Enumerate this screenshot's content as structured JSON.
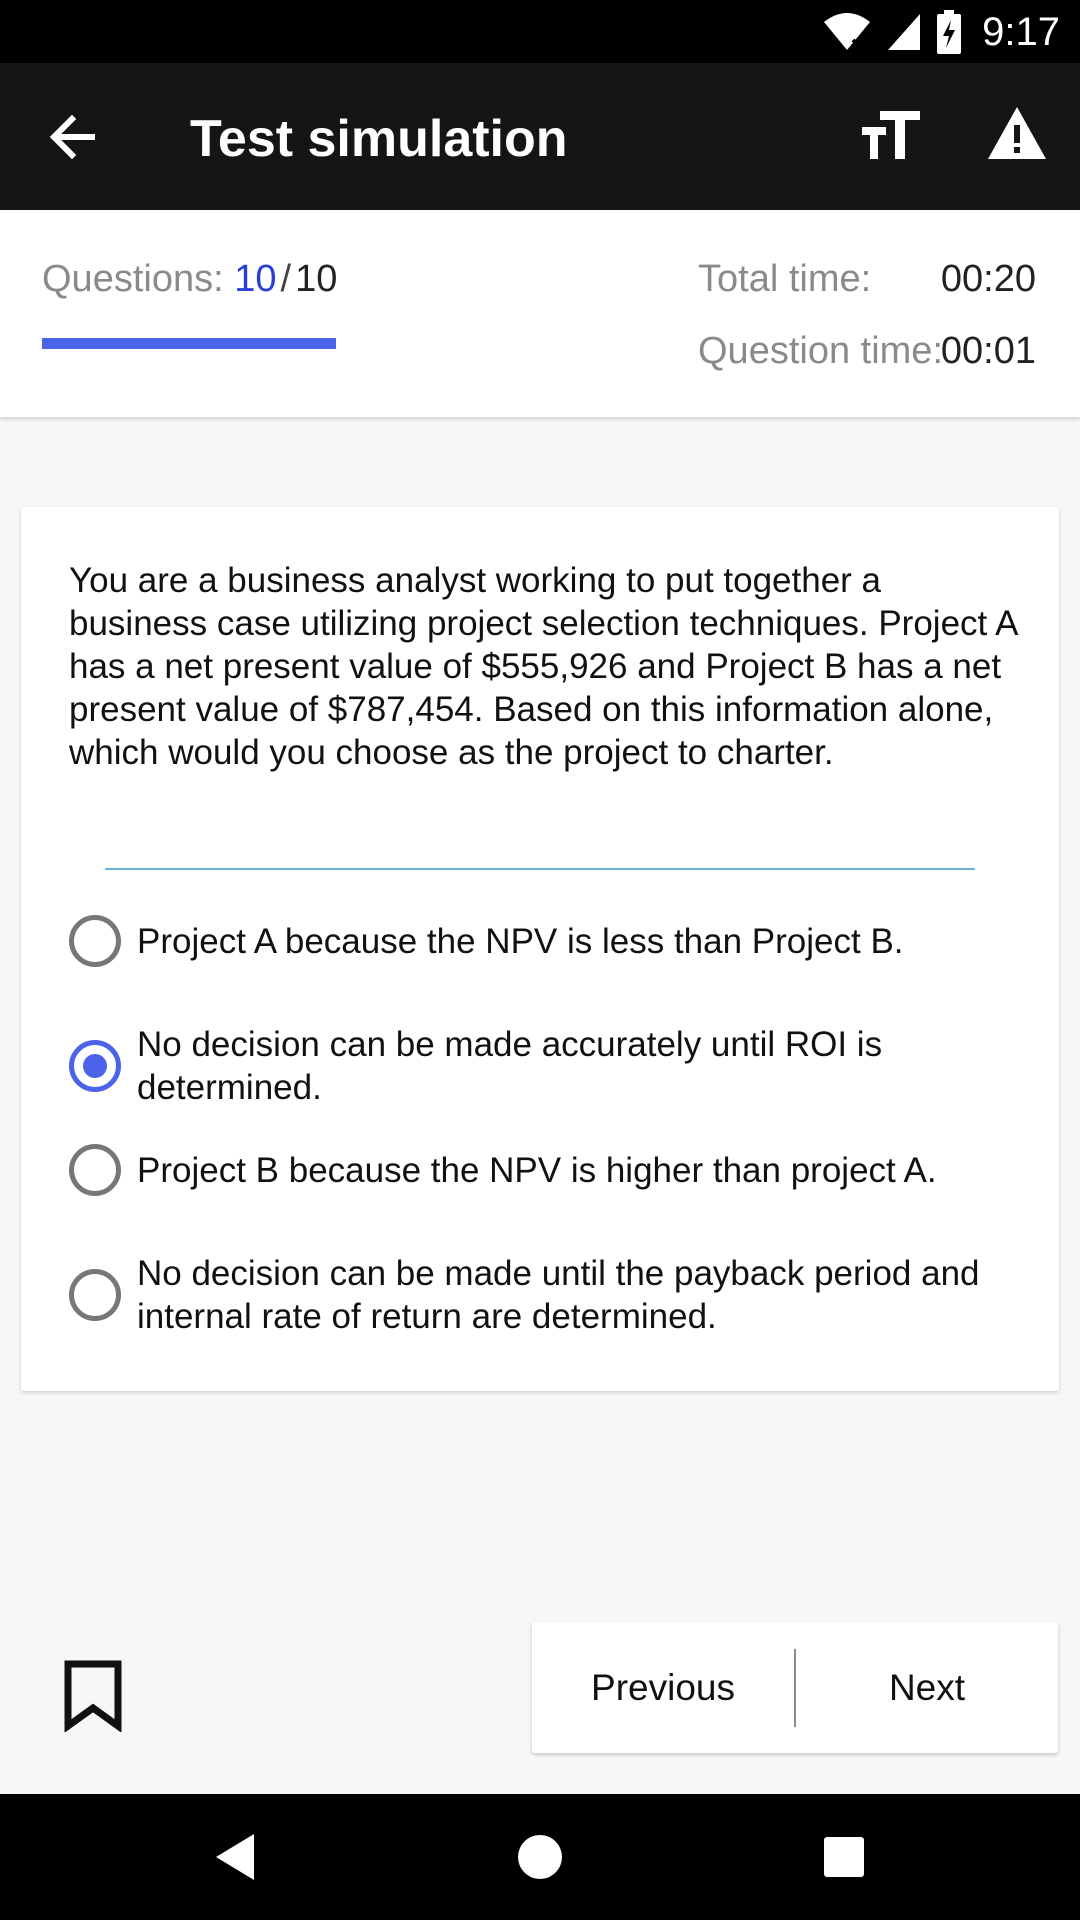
{
  "status_bar": {
    "time": "9:17"
  },
  "app_bar": {
    "title": "Test simulation"
  },
  "stats": {
    "questions_label": "Questions:",
    "current_question": "10",
    "separator": "/",
    "total_questions": "10",
    "progress_fraction": 1.0,
    "total_time_label": "Total time:",
    "total_time_value": "00:20",
    "question_time_label": "Question time:",
    "question_time_value": "00:01"
  },
  "question": {
    "text": "You are a business analyst working to put together a business case utilizing project selection techniques. Project A has a net present value of $555,926 and Project B has a net present value of $787,454. Based on this information alone, which would you choose as the project to charter.",
    "options": [
      {
        "label": "Project A because the NPV is less than Project B.",
        "selected": false
      },
      {
        "label": "No decision can be made accurately until ROI is determined.",
        "selected": true
      },
      {
        "label": "Project B because the NPV is higher than project A.",
        "selected": false
      },
      {
        "label": "No decision can be made until the payback period and internal rate of return are determined.",
        "selected": false
      }
    ]
  },
  "navigation": {
    "previous_label": "Previous",
    "next_label": "Next"
  },
  "colors": {
    "accent": "#4a63e8",
    "question_number": "#2a3fd6",
    "app_bar": "#151515"
  }
}
